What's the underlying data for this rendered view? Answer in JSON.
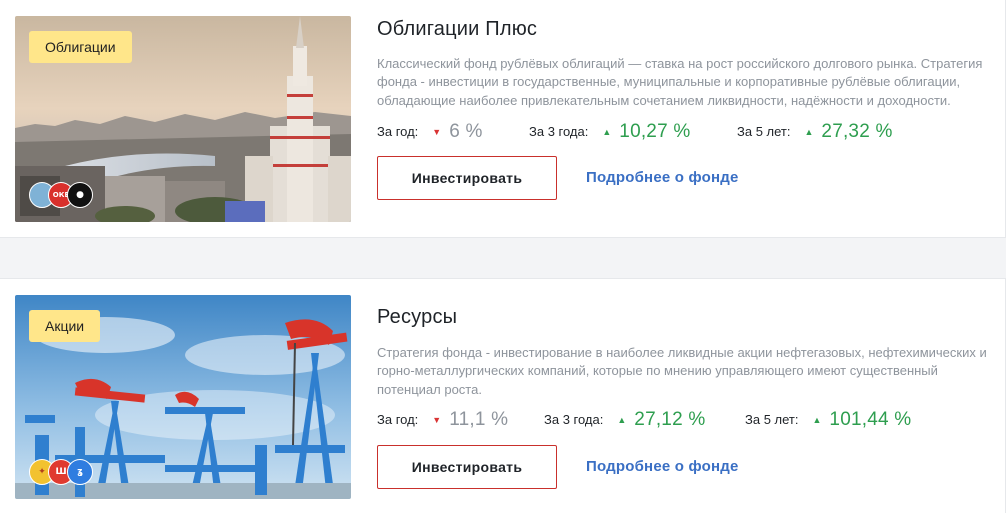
{
  "funds": [
    {
      "tag": "Облигации",
      "title": "Облигации Плюс",
      "description": "Классический фонд рублёвых облигаций — ставка на рост российского долгового рынка. Стратегия фонда - инвестиции в государственные, муниципальные и корпоративные рублёвые облигации, обладающие наиболее привлекательным сочетанием ликвидности, надёжности и доходности.",
      "image": "moscow-skyline-photo",
      "logos": [
        {
          "icon": "issuer-logo-blue",
          "color": "#7fb2d6",
          "text": ""
        },
        {
          "icon": "issuer-logo-red",
          "color": "#d9302c",
          "text": "ОКЕ"
        },
        {
          "icon": "issuer-logo-black",
          "color": "#111111",
          "text": "●"
        }
      ],
      "stats": [
        {
          "label": "За год:",
          "value": "6 %",
          "trend": "down"
        },
        {
          "label": "За 3 года:",
          "value": "10,27 %",
          "trend": "up"
        },
        {
          "label": "За 5 лет:",
          "value": "27,32 %",
          "trend": "up"
        }
      ],
      "invest_label": "Инвестировать",
      "more_label": "Подробнее о фонде"
    },
    {
      "tag": "Акции",
      "title": "Ресурсы",
      "description": "Стратегия фонда - инвестирование в наиболее ликвидные акции нефтегазовых, нефтехимических и горно-металлургических компаний, которые по мнению управляющего имеют существенный потенциал роста.",
      "image": "oil-pumpjacks-photo",
      "logos": [
        {
          "icon": "issuer-logo-yellow",
          "color": "#f2c230",
          "text": "✦"
        },
        {
          "icon": "issuer-logo-red",
          "color": "#e03a2f",
          "text": "Ш"
        },
        {
          "icon": "issuer-logo-blue",
          "color": "#2f7de0",
          "text": "ʓ"
        }
      ],
      "stats": [
        {
          "label": "За год:",
          "value": "11,1 %",
          "trend": "down"
        },
        {
          "label": "За 3 года:",
          "value": "27,12 %",
          "trend": "up"
        },
        {
          "label": "За 5 лет:",
          "value": "101,44 %",
          "trend": "up"
        }
      ],
      "invest_label": "Инвестировать",
      "more_label": "Подробнее о фонде"
    }
  ],
  "colors": {
    "accent_red": "#c9302c",
    "positive": "#2e9e4f",
    "negative": "#d93333",
    "link": "#3a6fc4",
    "tag_bg": "#ffe68a"
  }
}
